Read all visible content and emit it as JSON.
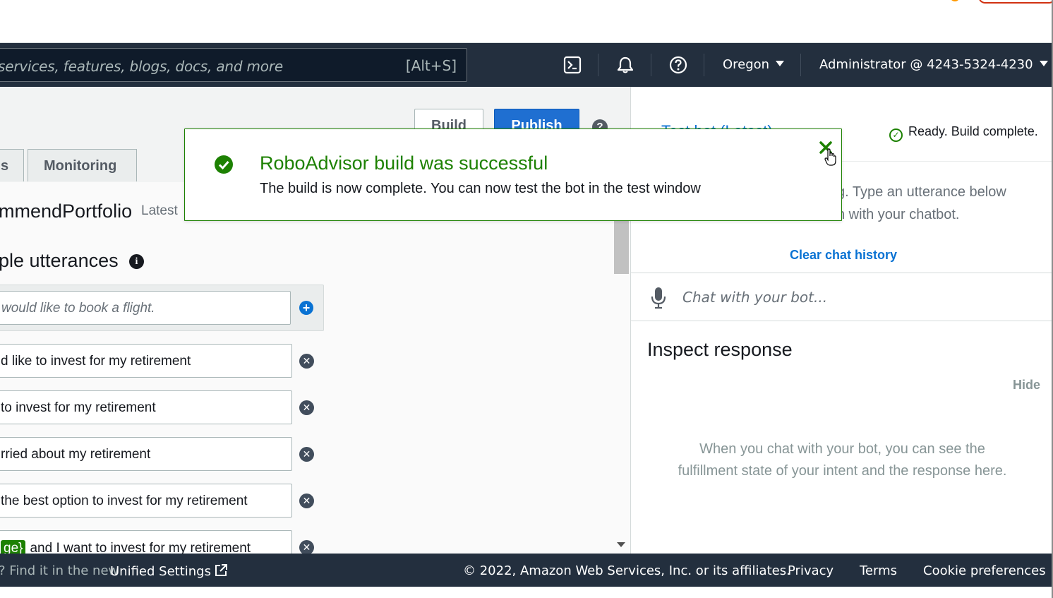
{
  "navbar": {
    "search_placeholder": "services, features, blogs, docs, and more",
    "search_shortcut": "[Alt+S]",
    "icons": [
      "cloudshell-icon",
      "bell-icon",
      "help-icon"
    ],
    "region": "Oregon",
    "account": "Administrator @ 4243-5324-4230"
  },
  "toolbar": {
    "build_label": "Build",
    "publish_label": "Publish",
    "help_label": "?"
  },
  "tabs": [
    {
      "label": "s"
    },
    {
      "label": "Monitoring"
    }
  ],
  "intent": {
    "name": "mmendPortfolio",
    "version": "Latest"
  },
  "utterances": {
    "section_title": "ple utterances",
    "new_placeholder": "would like to book a flight.",
    "items": [
      {
        "text": "d like to invest for my retirement"
      },
      {
        "text": "to invest for my retirement"
      },
      {
        "text": "rried about my retirement"
      },
      {
        "text": "the best option to invest for my retirement"
      },
      {
        "slot": "ge}",
        "text": "and I want to invest for my retirement"
      }
    ]
  },
  "flash": {
    "title": "RoboAdvisor build was successful",
    "message": "The build is now complete. You can now test the bot in the test window",
    "color": "#1d8102"
  },
  "test_panel": {
    "title": "Test bot (Latest)",
    "status": "Ready. Build complete.",
    "intro_line1": "g. Type an utterance below",
    "intro_line2": "n with your chatbot.",
    "clear_history": "Clear chat history",
    "chat_placeholder": "Chat with your bot...",
    "inspect_title": "Inspect response",
    "hide_label": "Hide",
    "inspect_empty_line1": "When you chat with your bot, you can see the",
    "inspect_empty_line2": "fulfillment state of your intent and the response here."
  },
  "footer": {
    "settings_prefix": "Find it in the new",
    "settings_link": "Unified Settings",
    "copyright": "© 2022, Amazon Web Services, Inc. or its affiliates.",
    "privacy": "Privacy",
    "terms": "Terms",
    "cookies": "Cookie preferences"
  },
  "colors": {
    "nav_bg": "#232f3e",
    "primary": "#0972d3",
    "success": "#1d8102"
  }
}
